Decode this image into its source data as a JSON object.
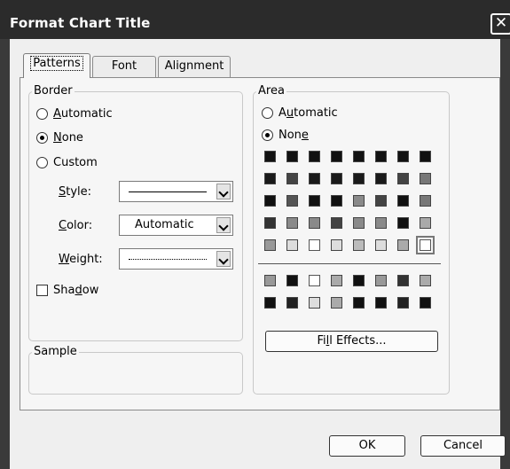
{
  "dialog": {
    "title": "Format Chart Title"
  },
  "tabs": [
    {
      "label": "Patterns",
      "active": true
    },
    {
      "label": "Font",
      "active": false
    },
    {
      "label": "Alignment",
      "active": false
    }
  ],
  "border": {
    "title": "Border",
    "options": [
      {
        "pre": "",
        "acc": "A",
        "post": "utomatic",
        "selected": false
      },
      {
        "pre": "",
        "acc": "N",
        "post": "one",
        "selected": true
      },
      {
        "pre": "Custom",
        "acc": "",
        "post": "",
        "selected": false
      }
    ],
    "style": {
      "pre": "",
      "acc": "S",
      "post": "tyle:"
    },
    "color": {
      "pre": "",
      "acc": "C",
      "post": "olor:",
      "value": "Automatic"
    },
    "weight": {
      "pre": "",
      "acc": "W",
      "post": "eight:"
    },
    "shadow": {
      "pre": "Sha",
      "acc": "d",
      "post": "ow",
      "checked": false
    }
  },
  "sample": {
    "title": "Sample"
  },
  "area": {
    "title": "Area",
    "options": [
      {
        "pre": "A",
        "acc": "u",
        "post": "tomatic",
        "selected": false
      },
      {
        "pre": "Non",
        "acc": "e",
        "post": "",
        "selected": true
      }
    ],
    "palette_main": [
      [
        "#111111",
        "#111111",
        "#111111",
        "#111111",
        "#111111",
        "#111111",
        "#111111",
        "#111111"
      ],
      [
        "#1a1a1a",
        "#444444",
        "#1a1a1a",
        "#1a1a1a",
        "#1a1a1a",
        "#1a1a1a",
        "#444444",
        "#777777"
      ],
      [
        "#111111",
        "#555555",
        "#111111",
        "#111111",
        "#8a8a8a",
        "#444444",
        "#111111",
        "#777777"
      ],
      [
        "#333333",
        "#8a8a8a",
        "#8a8a8a",
        "#444444",
        "#8a8a8a",
        "#8a8a8a",
        "#111111",
        "#aaaaaa"
      ],
      [
        "#999999",
        "#dddddd",
        "#ffffff",
        "#dddddd",
        "#bbbbbb",
        "#dddddd",
        "#aaaaaa",
        "#ffffff"
      ]
    ],
    "palette_chart": [
      [
        "#999999",
        "#111111",
        "#ffffff",
        "#aaaaaa",
        "#111111",
        "#999999",
        "#333333",
        "#aaaaaa"
      ],
      [
        "#111111",
        "#222222",
        "#dddddd",
        "#aaaaaa",
        "#111111",
        "#111111",
        "#222222",
        "#111111"
      ]
    ],
    "fill_effects": {
      "pre": "Fi",
      "acc": "l",
      "post": "l Effects..."
    }
  },
  "buttons": {
    "ok": "OK",
    "cancel": "Cancel"
  }
}
